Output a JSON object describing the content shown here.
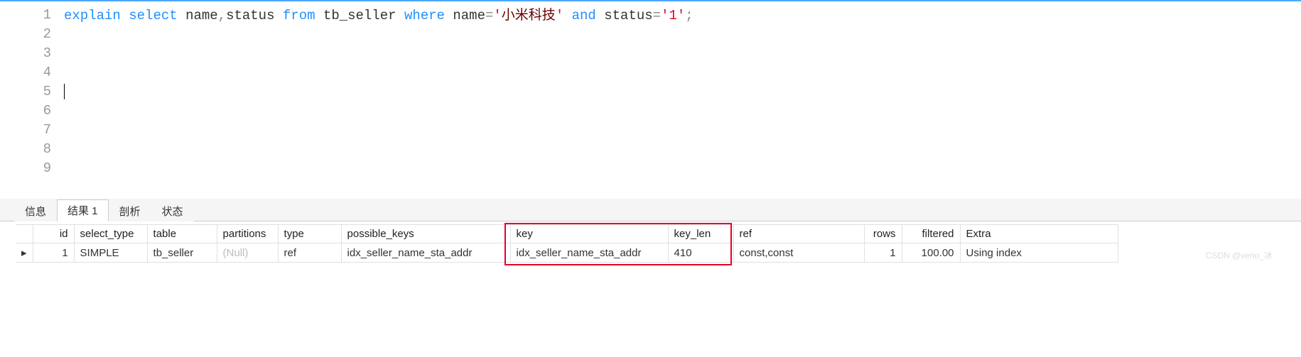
{
  "editor": {
    "lines": [
      1,
      2,
      3,
      4,
      5,
      6,
      7,
      8,
      9
    ],
    "sql_tokens": {
      "explain": "explain",
      "select": "select",
      "from": "from",
      "where": "where",
      "and": "and",
      "name": "name",
      "comma": ",",
      "status": "status",
      "space": " ",
      "tb_seller": "tb_seller",
      "eq": "=",
      "q": "'",
      "str1": "小米科技",
      "str2": "1",
      "semi": ";"
    }
  },
  "tabs": {
    "t1": "信息",
    "t2": "结果 1",
    "t3": "剖析",
    "t4": "状态",
    "active": 1
  },
  "columns": {
    "id": "id",
    "select_type": "select_type",
    "table": "table",
    "partitions": "partitions",
    "type": "type",
    "possible_keys": "possible_keys",
    "key": "key",
    "key_len": "key_len",
    "ref": "ref",
    "rows": "rows",
    "filtered": "filtered",
    "Extra": "Extra"
  },
  "row_marker": "▸",
  "row": {
    "id": "1",
    "select_type": "SIMPLE",
    "table": "tb_seller",
    "partitions": "(Null)",
    "type": "ref",
    "possible_keys": "idx_seller_name_sta_addr",
    "key": "idx_seller_name_sta_addr",
    "key_len": "410",
    "ref": "const,const",
    "rows": "1",
    "filtered": "100.00",
    "Extra": "Using index"
  },
  "watermark": "CSDN @veno_冰",
  "chart_data": {
    "type": "table",
    "title": "EXPLAIN result",
    "columns": [
      "id",
      "select_type",
      "table",
      "partitions",
      "type",
      "possible_keys",
      "key",
      "key_len",
      "ref",
      "rows",
      "filtered",
      "Extra"
    ],
    "rows": [
      [
        1,
        "SIMPLE",
        "tb_seller",
        null,
        "ref",
        "idx_seller_name_sta_addr",
        "idx_seller_name_sta_addr",
        410,
        "const,const",
        1,
        100.0,
        "Using index"
      ]
    ]
  }
}
